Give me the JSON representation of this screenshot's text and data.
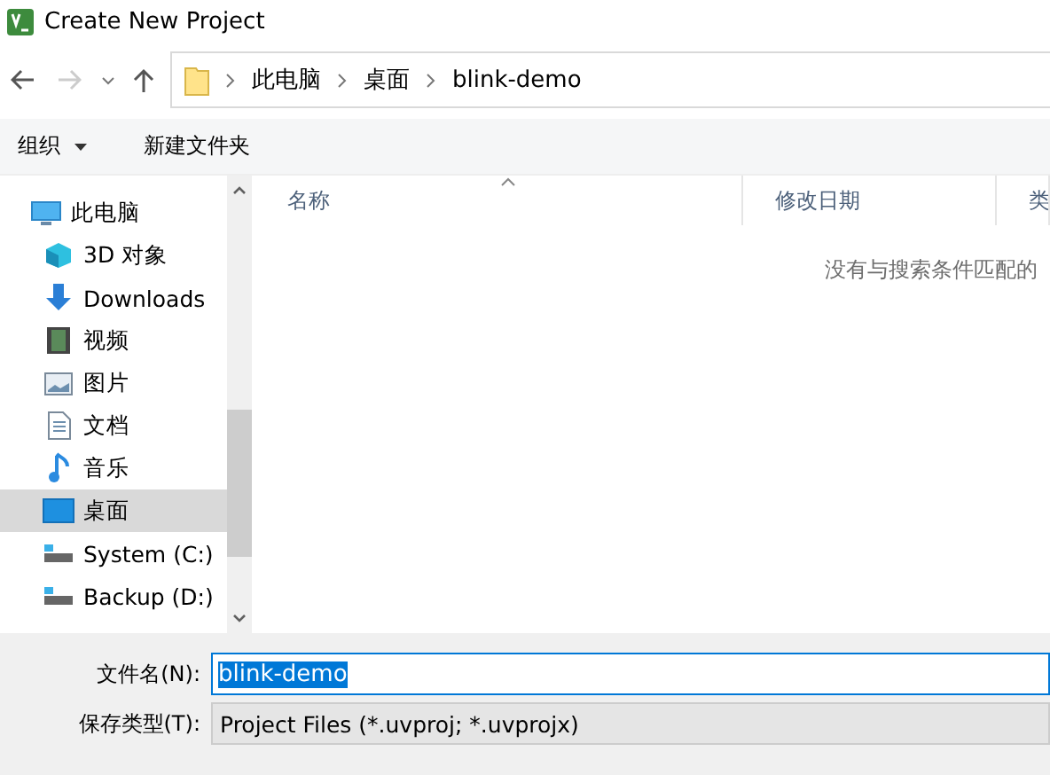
{
  "window": {
    "title": "Create New Project"
  },
  "address_bar": {
    "path": [
      "此电脑",
      "桌面",
      "blink-demo"
    ]
  },
  "toolbar": {
    "organize": "组织",
    "new_folder": "新建文件夹"
  },
  "sidebar": {
    "items": [
      {
        "label": "此电脑",
        "kind": "pc",
        "selected": false,
        "children": [
          {
            "label": "3D 对象",
            "kind": "cube",
            "selected": false
          },
          {
            "label": "Downloads",
            "kind": "download",
            "selected": false
          },
          {
            "label": "视频",
            "kind": "video",
            "selected": false
          },
          {
            "label": "图片",
            "kind": "picture",
            "selected": false
          },
          {
            "label": "文档",
            "kind": "document",
            "selected": false
          },
          {
            "label": "音乐",
            "kind": "music",
            "selected": false
          },
          {
            "label": "桌面",
            "kind": "desktop",
            "selected": true
          },
          {
            "label": "System (C:)",
            "kind": "drive",
            "selected": false
          },
          {
            "label": "Backup (D:)",
            "kind": "drive",
            "selected": false
          }
        ]
      }
    ]
  },
  "file_list": {
    "columns": [
      "名称",
      "修改日期",
      "类"
    ],
    "empty_message": "没有与搜索条件匹配的"
  },
  "footer": {
    "filename_label": "文件名(N):",
    "filename_value": "blink-demo",
    "type_label": "保存类型(T):",
    "type_value": "Project Files (*.uvproj; *.uvprojx)"
  }
}
